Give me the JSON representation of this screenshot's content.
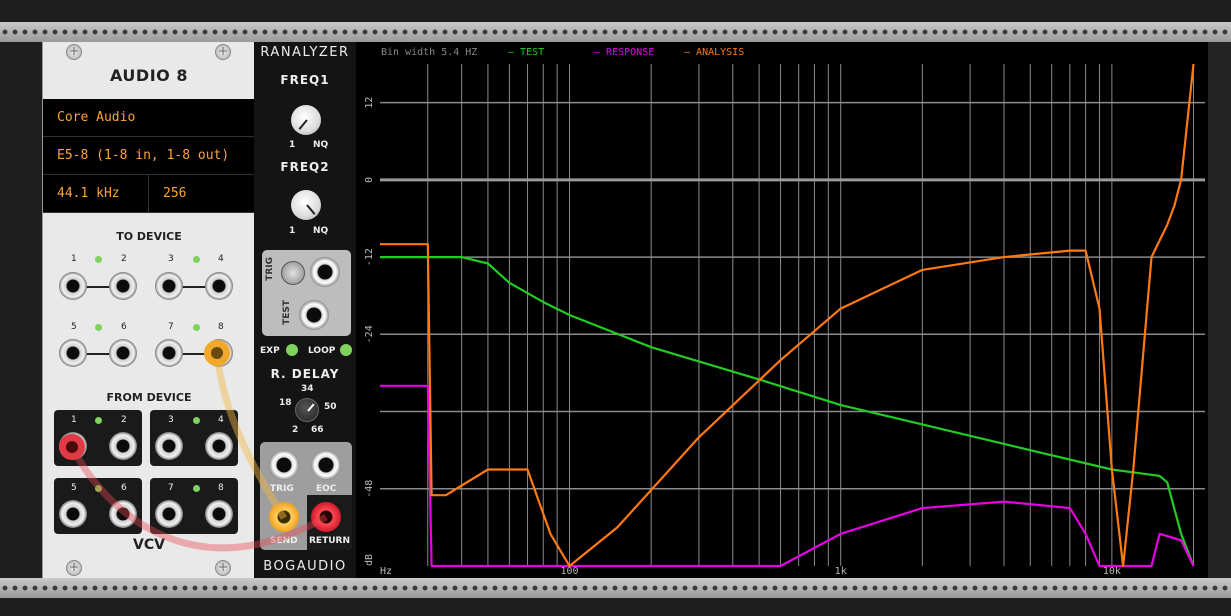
{
  "audio8": {
    "title": "AUDIO 8",
    "driver": "Core Audio",
    "device": "E5-8 (1-8 in, 1-8 out)",
    "sample_rate": "44.1 kHz",
    "block_size": "256",
    "to_device_label": "TO DEVICE",
    "from_device_label": "FROM DEVICE",
    "ports": [
      "1",
      "2",
      "3",
      "4",
      "5",
      "6",
      "7",
      "8"
    ],
    "brand": "VCV"
  },
  "ranalyzer": {
    "title": "RANALYZER",
    "freq1_label": "FREQ1",
    "freq2_label": "FREQ2",
    "knob_min": "1",
    "knob_max": "NQ",
    "trig_label": "TRIG",
    "test_label": "TEST",
    "exp_label": "EXP",
    "loop_label": "LOOP",
    "rdelay_label": "R. DELAY",
    "rdelay_values": [
      "2",
      "18",
      "34",
      "50",
      "66"
    ],
    "out_trig_label": "TRIG",
    "eoc_label": "EOC",
    "send_label": "SEND",
    "return_label": "RETURN",
    "brand": "BOGAUDIO"
  },
  "display": {
    "bin_width": "Bin width 5.4 HZ",
    "legend": {
      "test": "TEST",
      "response": "RESPONSE",
      "analysis": "ANALYSIS"
    },
    "colors": {
      "test": "#22cc22",
      "response": "#e600e6",
      "analysis": "#ff7a10"
    },
    "y_ticks": [
      "12",
      "0",
      "-12",
      "-24",
      "-48",
      "dB"
    ],
    "x_ticks": [
      "Hz",
      "100",
      "1k",
      "10k"
    ]
  },
  "chart_data": {
    "type": "line",
    "title": "",
    "xlabel": "Hz",
    "ylabel": "dB",
    "x_scale": "log",
    "xlim": [
      20,
      22050
    ],
    "ylim": [
      -60,
      18
    ],
    "series": [
      {
        "name": "TEST",
        "x": [
          20,
          40,
          50,
          60,
          80,
          100,
          200,
          500,
          1000,
          2000,
          5000,
          10000,
          15000,
          16000,
          18000,
          20000
        ],
        "y": [
          -12,
          -12,
          -13,
          -16,
          -19,
          -21,
          -26,
          -31,
          -35,
          -38,
          -42,
          -45,
          -46,
          -47,
          -55,
          -60
        ]
      },
      {
        "name": "RESPONSE",
        "x": [
          20,
          30,
          31,
          35,
          100,
          600,
          1000,
          2000,
          4000,
          7000,
          8000,
          9000,
          14000,
          15000,
          18000,
          20000
        ],
        "y": [
          -32,
          -32,
          -60,
          -60,
          -60,
          -60,
          -55,
          -51,
          -50,
          -51,
          -55,
          -60,
          -60,
          -55,
          -56,
          -60
        ]
      },
      {
        "name": "ANALYSIS",
        "x": [
          20,
          30,
          31,
          35,
          50,
          70,
          85,
          100,
          150,
          300,
          600,
          1000,
          2000,
          4000,
          7000,
          8000,
          9000,
          10000,
          11000,
          12000,
          14000,
          16000,
          17000,
          18000,
          20000
        ],
        "y": [
          -10,
          -10,
          -49,
          -49,
          -45,
          -45,
          -55,
          -60,
          -54,
          -40,
          -28,
          -20,
          -14,
          -12,
          -11,
          -11,
          -20,
          -45,
          -60,
          -45,
          -12,
          -7,
          -4,
          0,
          18
        ]
      }
    ]
  }
}
